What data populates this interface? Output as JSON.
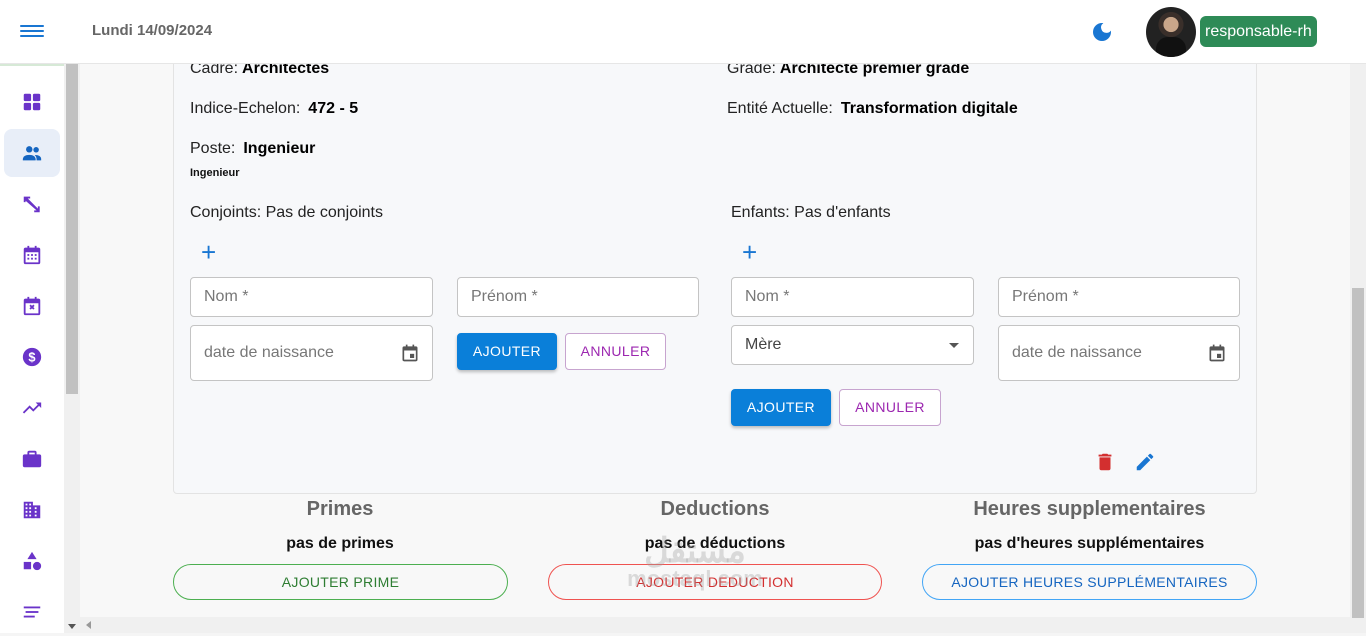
{
  "header": {
    "date": "Lundi 14/09/2024",
    "role_badge": "responsable-rh"
  },
  "sidebar": {
    "items": [
      {
        "icon": "dashboard-icon"
      },
      {
        "icon": "people-icon",
        "active": true
      },
      {
        "icon": "transfer-icon"
      },
      {
        "icon": "calendar-icon"
      },
      {
        "icon": "calendar-cancel-icon"
      },
      {
        "icon": "dollar-icon"
      },
      {
        "icon": "trending-up-icon"
      },
      {
        "icon": "briefcase-icon"
      },
      {
        "icon": "building-icon"
      },
      {
        "icon": "shapes-icon"
      },
      {
        "icon": "list-icon"
      }
    ]
  },
  "profile": {
    "cadre_label": "Cadre:",
    "cadre_value": "Architectes",
    "grade_label": "Grade:",
    "grade_value": "Architecte premier grade",
    "indice_label": "Indice-Echelon:",
    "indice_value": "472 - 5",
    "entite_label": "Entité Actuelle:",
    "entite_value": "Transformation digitale",
    "poste_label": "Poste:",
    "poste_value": "Ingenieur",
    "poste_sub": "Ingenieur"
  },
  "conjoints": {
    "label": "Conjoints: Pas de conjoints",
    "nom_placeholder": "Nom *",
    "prenom_placeholder": "Prénom *",
    "date_placeholder": "date de naissance",
    "add_button": "AJOUTER",
    "cancel_button": "ANNULER"
  },
  "enfants": {
    "label": "Enfants: Pas d'enfants",
    "nom_placeholder": "Nom *",
    "prenom_placeholder": "Prénom *",
    "parent_select": "Mère",
    "date_placeholder": "date de naissance",
    "add_button": "AJOUTER",
    "cancel_button": "ANNULER"
  },
  "primes": {
    "title": "Primes",
    "empty": "pas de primes",
    "button": "AJOUTER PRIME"
  },
  "deductions": {
    "title": "Deductions",
    "empty": "pas de déductions",
    "button": "AJOUTER DEDUCTION"
  },
  "heures": {
    "title": "Heures supplementaires",
    "empty": "pas d'heures supplémentaires",
    "button": "AJOUTER HEURES SUPPLÉMENTAIRES"
  },
  "watermark": {
    "arabic": "مستقل",
    "latin": "mostaql.com"
  },
  "colors": {
    "primary": "#0a7fd9",
    "role_badge": "#2e8b57",
    "sidebar_icon": "#6a33c9",
    "delete": "#d32f2f"
  }
}
